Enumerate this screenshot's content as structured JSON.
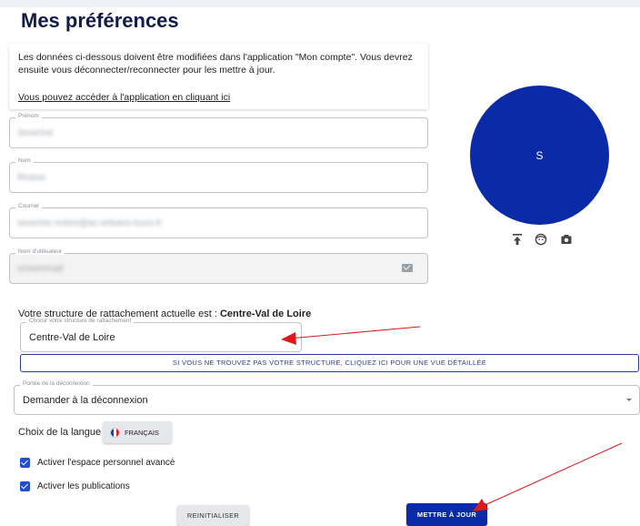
{
  "page": {
    "title": "Mes préférences"
  },
  "notice": {
    "text": "Les données ci-dessous doivent être modifiées dans l'application \"Mon compte\". Vous devrez ensuite vous déconnecter/reconnecter pour les mettre à jour.",
    "link": "Vous pouvez accéder à l'application en cliquant ici"
  },
  "fields": {
    "prenom": {
      "label": "Prénom",
      "value": "Severine"
    },
    "nom": {
      "label": "Nom",
      "value": "Riviere"
    },
    "courriel": {
      "label": "Courriel",
      "value": "severine.riviere@ac-orleans-tours.fr"
    },
    "username": {
      "label": "Nom d'utilisateur",
      "value": "srivieremail"
    }
  },
  "avatar": {
    "initial": "S"
  },
  "structure": {
    "text": "Votre structure de rattachement actuelle est :",
    "current": "Centre-Val de Loire",
    "select_label": "Choisir votre structure de rattachement",
    "select_value": "Centre-Val de Loire",
    "detail_button": "SI VOUS NE TROUVEZ PAS VOTRE STRUCTURE, CLIQUEZ ICI POUR UNE VUE DÉTAILLÉE"
  },
  "logout": {
    "label": "Portée de la déconnexion",
    "value": "Demander à la déconnexion"
  },
  "language": {
    "label": "Choix de la langue",
    "button": "FRANÇAIS"
  },
  "options": {
    "advanced": "Activer l'espace personnel avancé",
    "publications": "Activer les publications"
  },
  "buttons": {
    "reset": "REINITIALISER",
    "update": "METTRE À JOUR"
  },
  "colors": {
    "primary": "#0a2aa8",
    "title": "#101b4a",
    "annotation": "#e01818"
  },
  "icons": {
    "upload": "upload-icon",
    "face": "face-icon",
    "camera": "camera-icon",
    "mail": "mail-icon"
  }
}
